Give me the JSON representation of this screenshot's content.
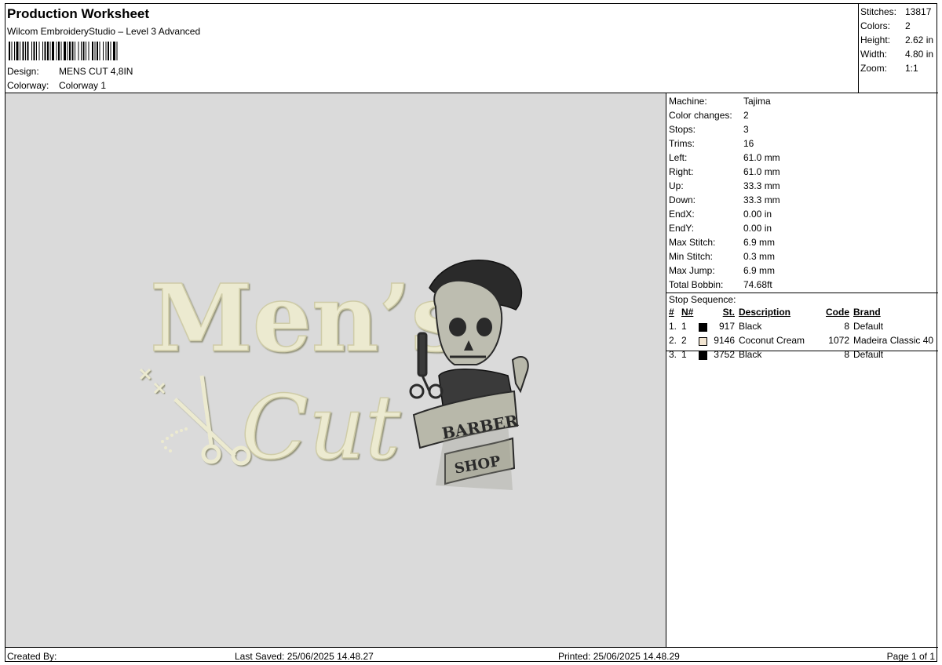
{
  "header": {
    "title": "Production Worksheet",
    "subtitle": "Wilcom EmbroideryStudio – Level 3 Advanced",
    "design_label": "Design:",
    "design_value": "MENS CUT 4,8IN",
    "colorway_label": "Colorway:",
    "colorway_value": "Colorway 1"
  },
  "summary": [
    {
      "label": "Stitches:",
      "value": "13817"
    },
    {
      "label": "Colors:",
      "value": "2"
    },
    {
      "label": "Height:",
      "value": "2.62 in"
    },
    {
      "label": "Width:",
      "value": "4.80 in"
    },
    {
      "label": "Zoom:",
      "value": "1:1"
    }
  ],
  "design": {
    "line1": "Men’s",
    "line2": "Cut",
    "banner_top": "BARBER",
    "banner_bottom": "SHOP",
    "thread_cream": "#ecead0",
    "thread_black": "#2a2a2a"
  },
  "machine_info": [
    {
      "label": "Machine:",
      "value": "Tajima"
    },
    {
      "label": "Color changes:",
      "value": "2"
    },
    {
      "label": "Stops:",
      "value": "3"
    },
    {
      "label": "Trims:",
      "value": "16"
    },
    {
      "label": "Left:",
      "value": "61.0 mm"
    },
    {
      "label": "Right:",
      "value": "61.0 mm"
    },
    {
      "label": "Up:",
      "value": "33.3 mm"
    },
    {
      "label": "Down:",
      "value": "33.3 mm"
    },
    {
      "label": "EndX:",
      "value": "0.00 in"
    },
    {
      "label": "EndY:",
      "value": "0.00 in"
    },
    {
      "label": "Max Stitch:",
      "value": "6.9 mm"
    },
    {
      "label": "Min Stitch:",
      "value": "0.3 mm"
    },
    {
      "label": "Max Jump:",
      "value": "6.9 mm"
    },
    {
      "label": "Total Bobbin:",
      "value": "74.68ft"
    }
  ],
  "stop_sequence": {
    "title": "Stop Sequence:",
    "headers": {
      "num": "#",
      "n": "N#",
      "st": "St.",
      "desc": "Description",
      "code": "Code",
      "brand": "Brand"
    },
    "rows": [
      {
        "num": "1.",
        "n": "1",
        "color": "#000000",
        "st": "917",
        "desc": "Black",
        "code": "8",
        "brand": "Default"
      },
      {
        "num": "2.",
        "n": "2",
        "color": "#f3e6d2",
        "st": "9146",
        "desc": "Coconut Cream",
        "code": "1072",
        "brand": "Madeira Classic 40"
      },
      {
        "num": "3.",
        "n": "1",
        "color": "#000000",
        "st": "3752",
        "desc": "Black",
        "code": "8",
        "brand": "Default"
      }
    ]
  },
  "footer": {
    "created_by": "Created By:",
    "last_saved": "Last Saved: 25/06/2025 14.48.27",
    "printed": "Printed: 25/06/2025 14.48.29",
    "page": "Page 1 of 1"
  }
}
